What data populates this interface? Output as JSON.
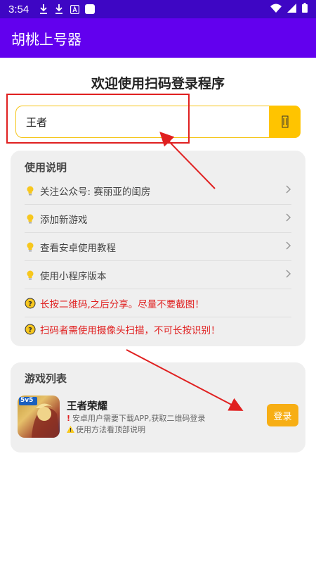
{
  "status_bar": {
    "time": "3:54"
  },
  "app_bar": {
    "title": "胡桃上号器"
  },
  "welcome": {
    "title": "欢迎使用扫码登录程序"
  },
  "search": {
    "value": "王者"
  },
  "instructions": {
    "title": "使用说明",
    "items": [
      {
        "label": "关注公众号: 赛丽亚的闺房",
        "icon": "bulb-icon"
      },
      {
        "label": "添加新游戏",
        "icon": "bulb-icon"
      },
      {
        "label": "查看安卓使用教程",
        "icon": "bulb-icon"
      },
      {
        "label": "使用小程序版本",
        "icon": "bulb-icon"
      }
    ],
    "warnings": [
      {
        "label": "长按二维码,之后分享。尽量不要截图！",
        "icon": "question-icon"
      },
      {
        "label": "扫码者需使用摄像头扫描，不可长按识别！",
        "icon": "question-icon"
      }
    ]
  },
  "games": {
    "title": "游戏列表",
    "items": [
      {
        "name": "王者荣耀",
        "note1": "安卓用户需要下载APP,获取二维码登录",
        "note2": "使用方法看顶部说明",
        "icon_label": "5v5",
        "login_label": "登录"
      }
    ]
  },
  "colors": {
    "status_bar": "#3e06c4",
    "app_bar": "#6200ee",
    "accent_yellow": "#ffc400",
    "warning_red": "#e02020",
    "login_orange": "#f7ae14"
  }
}
